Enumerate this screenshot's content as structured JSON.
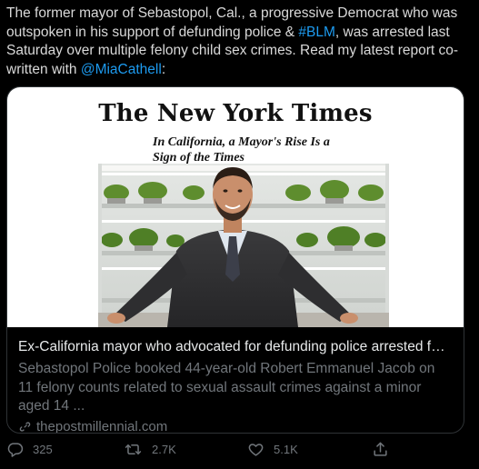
{
  "tweet": {
    "text_before": "The former mayor of Sebastopol, Cal., a progressive Democrat who was outspoken in his support of defunding police & ",
    "hashtag": "#BLM",
    "text_middle": ", was arrested last Saturday over multiple felony child sex crimes. Read my latest report co-written with ",
    "mention": "@MiaCathell",
    "text_after": ":"
  },
  "card": {
    "image": {
      "logo_text": "The New York Times",
      "headline": "In California, a Mayor's Rise Is a Sign of the Times"
    },
    "title": "Ex-California mayor who advocated for defunding police arrested for c...",
    "description": "Sebastopol Police booked 44-year-old Robert Emmanuel Jacob on 11 felony counts related to sexual assault crimes against a minor aged 14 ...",
    "domain": "thepostmillennial.com"
  },
  "actions": {
    "reply_count": "325",
    "retweet_count": "2.7K",
    "like_count": "5.1K"
  },
  "colors": {
    "link": "#1d9bf0",
    "secondary_text": "#71767b",
    "border": "#2f3336"
  }
}
